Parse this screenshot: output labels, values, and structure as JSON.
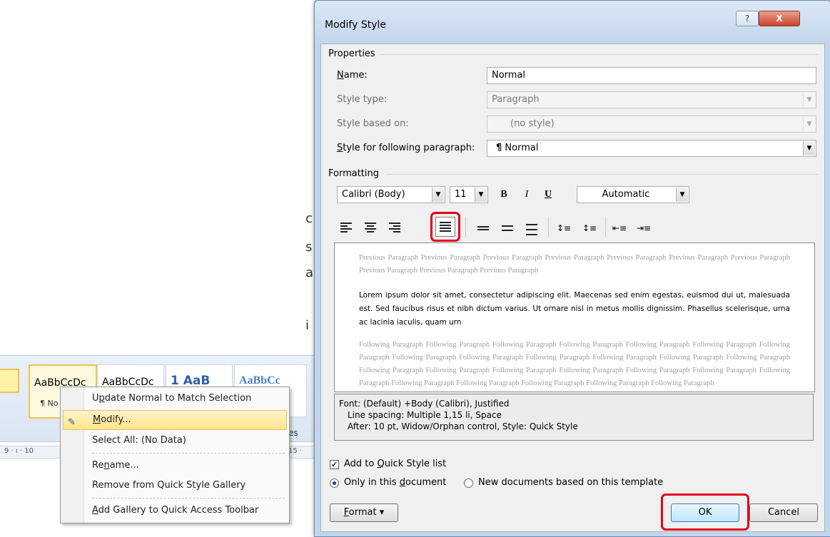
{
  "background": {
    "gallery_samples": [
      {
        "sample": "AaBbCcDc",
        "label": "¶ No"
      },
      {
        "sample": "AaBbCcDc",
        "label": ""
      },
      {
        "sample": "1  AaB",
        "label": ""
      },
      {
        "sample": "AaBbCc",
        "label": ""
      }
    ],
    "ruler_marks": [
      "9  ·  ı  ·  10",
      "15  ·"
    ],
    "left_snippets": [
      "c",
      "s",
      "a",
      "i"
    ],
    "partial_text": "es"
  },
  "context_menu": {
    "items": [
      {
        "label": "Update Normal to Match Selection",
        "key": "p"
      },
      {
        "label": "Modify...",
        "key": "M"
      },
      {
        "label": "Select All: (No Data)",
        "key": ""
      },
      {
        "label": "Rename...",
        "key": "n"
      },
      {
        "label": "Remove from Quick Style Gallery",
        "key": ""
      },
      {
        "label": "Add Gallery to Quick Access Toolbar",
        "key": "A"
      }
    ]
  },
  "dialog": {
    "title": "Modify Style",
    "help_glyph": "?",
    "close_glyph": "X",
    "properties": {
      "group_title": "Properties",
      "name_label": "Name:",
      "name_value": "Normal",
      "style_type_label": "Style type:",
      "style_type_value": "Paragraph",
      "based_on_label": "Style based on:",
      "based_on_value": "(no style)",
      "following_label": "Style for following paragraph:",
      "following_value": "Normal",
      "paragraph_mark": "¶"
    },
    "formatting": {
      "group_title": "Formatting",
      "font": "Calibri (Body)",
      "size": "11",
      "bold": "B",
      "italic": "I",
      "underline": "U",
      "color": "Automatic",
      "spacing_glyphs": [
        "↕≡",
        "↕≡",
        "⇤≡",
        "⇥≡"
      ]
    },
    "preview": {
      "previous_paragraph": "Previous Paragraph Previous Paragraph Previous Paragraph Previous Paragraph Previous Paragraph Previous Paragraph Previous Paragraph Previous Paragraph Previous Paragraph Previous Paragraph",
      "body": "Lorem ipsum dolor sit amet, consectetur adipiscing elit. Maecenas sed enim egestas, euismod dui ut, malesuada est. Sed faucibus risus et nibh dictum varius. Ut ornare nisl in metus mollis dignissim. Phasellus scelerisque, urna ac lacinia iaculis, quam urn",
      "following_paragraph": "Following Paragraph Following Paragraph Following Paragraph Following Paragraph Following Paragraph Following Paragraph Following Paragraph Following Paragraph Following Paragraph Following Paragraph Following Paragraph Following Paragraph Following Paragraph Following Paragraph Following Paragraph Following Paragraph Following Paragraph Following Paragraph Following Paragraph Following Paragraph Following Paragraph Following Paragraph Following Paragraph Following Paragraph Following Paragraph"
    },
    "description": {
      "line1": "Font: (Default) +Body (Calibri), Justified",
      "line2": "Line spacing:  Multiple 1,15 li, Space",
      "line3": "After:  10 pt, Widow/Orphan control, Style: Quick Style"
    },
    "options": {
      "add_quick_style": "Add to Quick Style list",
      "only_this_doc": "Only in this document",
      "new_docs": "New documents based on this template"
    },
    "buttons": {
      "format": "Format",
      "format_arrow": "▾",
      "ok": "OK",
      "cancel": "Cancel"
    },
    "colors": {
      "highlight_ring": "#e3001b",
      "frame": "#c3d5ea"
    }
  }
}
